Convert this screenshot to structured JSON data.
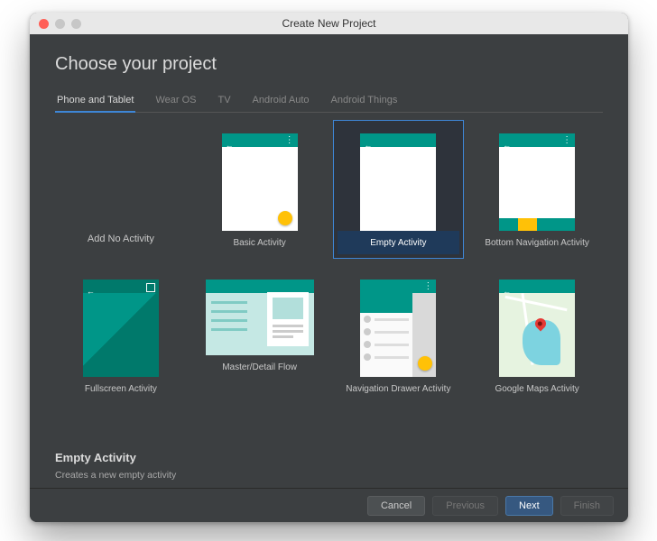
{
  "window": {
    "title": "Create New Project"
  },
  "heading": "Choose your project",
  "tabs": [
    {
      "label": "Phone and Tablet",
      "active": true
    },
    {
      "label": "Wear OS",
      "active": false
    },
    {
      "label": "TV",
      "active": false
    },
    {
      "label": "Android Auto",
      "active": false
    },
    {
      "label": "Android Things",
      "active": false
    }
  ],
  "templates": [
    {
      "key": "none",
      "label": "Add No Activity"
    },
    {
      "key": "basic",
      "label": "Basic Activity"
    },
    {
      "key": "empty",
      "label": "Empty Activity",
      "selected": true
    },
    {
      "key": "bottomnav",
      "label": "Bottom Navigation Activity"
    },
    {
      "key": "fullscreen",
      "label": "Fullscreen Activity"
    },
    {
      "key": "masterdetail",
      "label": "Master/Detail Flow"
    },
    {
      "key": "navdrawer",
      "label": "Navigation Drawer Activity"
    },
    {
      "key": "maps",
      "label": "Google Maps Activity"
    }
  ],
  "description": {
    "title": "Empty Activity",
    "subtitle": "Creates a new empty activity"
  },
  "buttons": {
    "cancel": "Cancel",
    "previous": "Previous",
    "next": "Next",
    "finish": "Finish"
  },
  "colors": {
    "accent": "#3e86d6",
    "teal": "#009688",
    "amber": "#ffc107",
    "bg": "#3c3f41"
  }
}
